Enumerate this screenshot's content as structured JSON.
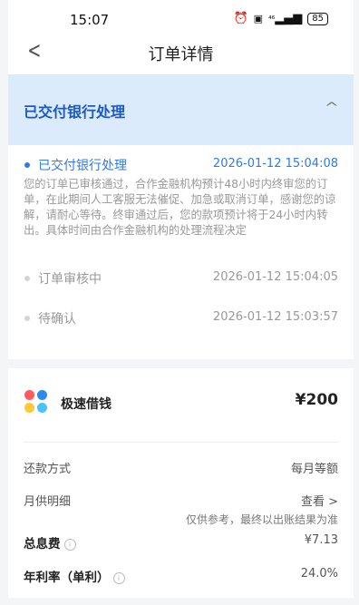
{
  "status_bar": {
    "time": "15:07",
    "icons": [
      "alarm-icon",
      "nfc-icon",
      "signal-icon"
    ],
    "network": "⁴⁶",
    "battery": "85"
  },
  "nav": {
    "back_icon": "chevron-left-icon",
    "title": "订单详情"
  },
  "status_panel": {
    "title": "已交付银行处理",
    "toggle_icon": "chevron-up-icon"
  },
  "timeline": [
    {
      "label": "已交付银行处理",
      "time": "2026-01-12 15:04:08",
      "active": true,
      "description": "您的订单已审核通过，合作金融机构预计48小时内终审您的订单，在此期间人工客服无法催促、加急或取消订单，感谢您的谅解，请耐心等待。终审通过后，您的款项预计将于24小时内转出。具体时间由合作金融机构的处理流程决定"
    },
    {
      "label": "订单审核中",
      "time": "2026-01-12 15:04:05",
      "active": false
    },
    {
      "label": "待确认",
      "time": "2026-01-12 15:03:57",
      "active": false
    }
  ],
  "product": {
    "name": "极速借钱",
    "amount": "¥200",
    "logo_colors": [
      "#ff5a5f",
      "#2f88f0",
      "#ffc83a",
      "#4cc3f5"
    ]
  },
  "details": {
    "repay_method_label": "还款方式",
    "repay_method_value": "每月等额",
    "monthly_label": "月供明细",
    "monthly_link": "查看",
    "monthly_note": "仅供参考，最终以出账结果为准",
    "interest_label": "总息费",
    "interest_value": "¥7.13",
    "rate_label": "年利率（单利）",
    "rate_value": "24.0%"
  },
  "colors": {
    "accent": "#2d7be6",
    "panel_bg": "#dcebfb",
    "panel_title": "#1a59c4"
  }
}
